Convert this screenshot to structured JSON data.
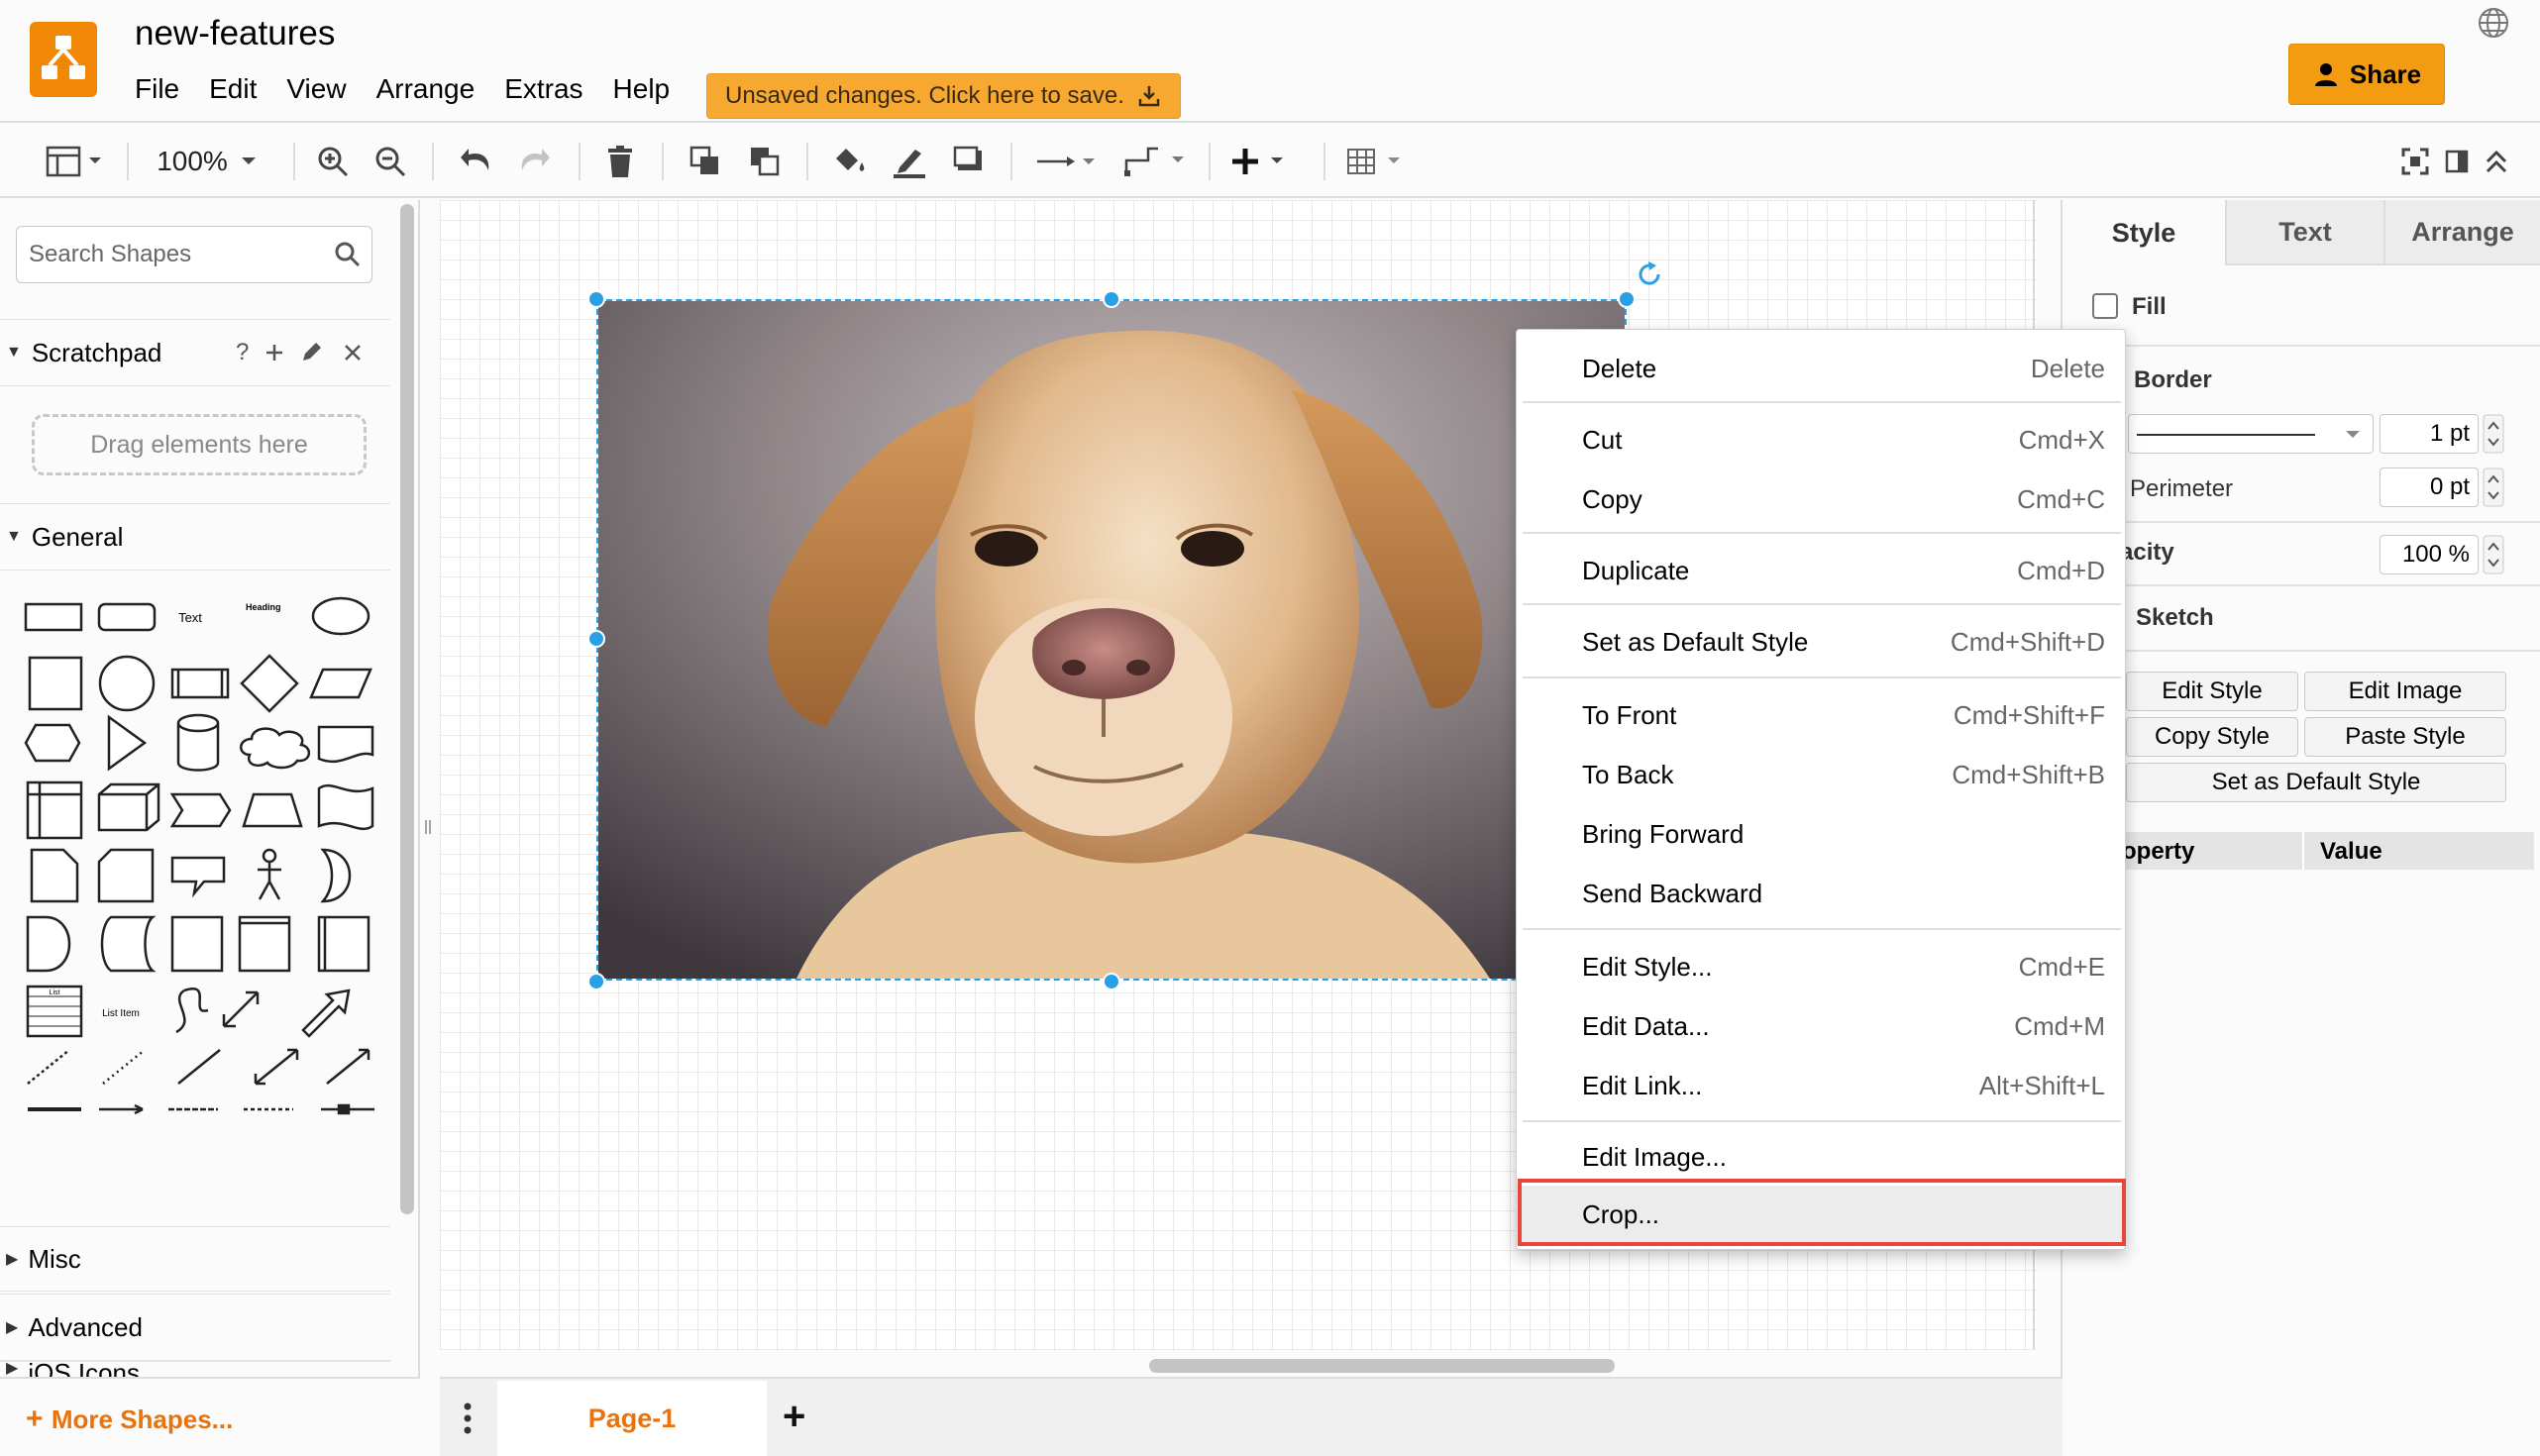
{
  "app": {
    "doc_title": "new-features",
    "menus": [
      "File",
      "Edit",
      "View",
      "Arrange",
      "Extras",
      "Help"
    ],
    "unsaved_notice": "Unsaved changes. Click here to save.",
    "share_label": "Share",
    "brand_color": "#f08705"
  },
  "toolbar": {
    "zoom": "100%",
    "icons": [
      "format-panel-icon",
      "zoom-in-icon",
      "zoom-out-icon",
      "undo-icon",
      "redo-icon",
      "delete-icon",
      "to-front-icon",
      "to-back-icon",
      "fill-color-icon",
      "line-color-icon",
      "shadow-icon",
      "connection-icon",
      "waypoints-icon",
      "insert-icon",
      "table-icon",
      "fullscreen-icon",
      "format-toggle-icon",
      "collapse-icon"
    ]
  },
  "sidebar": {
    "search_placeholder": "Search Shapes",
    "scratchpad_title": "Scratchpad",
    "scratchpad_help": "?",
    "drag_hint": "Drag elements here",
    "general_title": "General",
    "shape_text_label": "Text",
    "shape_heading_label": "Heading",
    "shape_list_label": "List",
    "shape_list_item_label": "List Item",
    "misc_title": "Misc",
    "advanced_title": "Advanced",
    "ios_title": "iOS Icons",
    "more_shapes": "More Shapes..."
  },
  "format_panel": {
    "tabs": [
      "Style",
      "Text",
      "Arrange"
    ],
    "fill_label": "Fill",
    "border_label": "Border",
    "border_width": "1 pt",
    "perimeter_label": "Perimeter",
    "perimeter_value": "0 pt",
    "opacity_label": "acity",
    "opacity_value": "100 %",
    "sketch_label": "Sketch",
    "buttons": {
      "edit_style": "Edit Style",
      "edit_image": "Edit Image",
      "copy_style": "Copy Style",
      "paste_style": "Paste Style",
      "set_default": "Set as Default Style"
    },
    "table_headers": [
      "operty",
      "Value"
    ]
  },
  "context_menu": {
    "items": [
      {
        "label": "Delete",
        "shortcut": "Delete"
      },
      {
        "label": "Cut",
        "shortcut": "Cmd+X"
      },
      {
        "label": "Copy",
        "shortcut": "Cmd+C"
      },
      {
        "label": "Duplicate",
        "shortcut": "Cmd+D"
      },
      {
        "label": "Set as Default Style",
        "shortcut": "Cmd+Shift+D"
      },
      {
        "label": "To Front",
        "shortcut": "Cmd+Shift+F"
      },
      {
        "label": "To Back",
        "shortcut": "Cmd+Shift+B"
      },
      {
        "label": "Bring Forward",
        "shortcut": ""
      },
      {
        "label": "Send Backward",
        "shortcut": ""
      },
      {
        "label": "Edit Style...",
        "shortcut": "Cmd+E"
      },
      {
        "label": "Edit Data...",
        "shortcut": "Cmd+M"
      },
      {
        "label": "Edit Link...",
        "shortcut": "Alt+Shift+L"
      },
      {
        "label": "Edit Image...",
        "shortcut": ""
      },
      {
        "label": "Crop...",
        "shortcut": ""
      }
    ],
    "highlight_color": "#e8453c"
  },
  "pages": {
    "active": "Page-1"
  }
}
